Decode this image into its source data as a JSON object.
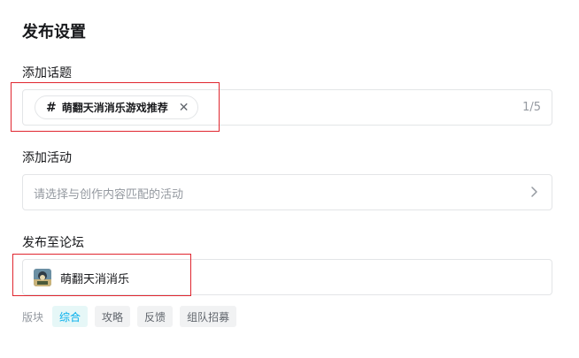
{
  "page": {
    "title": "发布设置"
  },
  "topic": {
    "label": "添加话题",
    "chip_text": "萌翻天消消乐游戏推荐",
    "hash_symbol": "#",
    "remove_symbol": "✕",
    "count": "1/5"
  },
  "activity": {
    "label": "添加活动",
    "placeholder": "请选择与创作内容匹配的活动",
    "icon": "chevron-right-icon"
  },
  "forum": {
    "label": "发布至论坛",
    "name": "萌翻天消消乐",
    "section_label": "版块",
    "sections": [
      "综合",
      "攻略",
      "反馈",
      "组队招募"
    ],
    "active_section": "综合"
  },
  "colors": {
    "highlight_border": "#e0262f",
    "active_tag_bg": "#e6f7f7",
    "active_tag_text": "#00aeec"
  }
}
